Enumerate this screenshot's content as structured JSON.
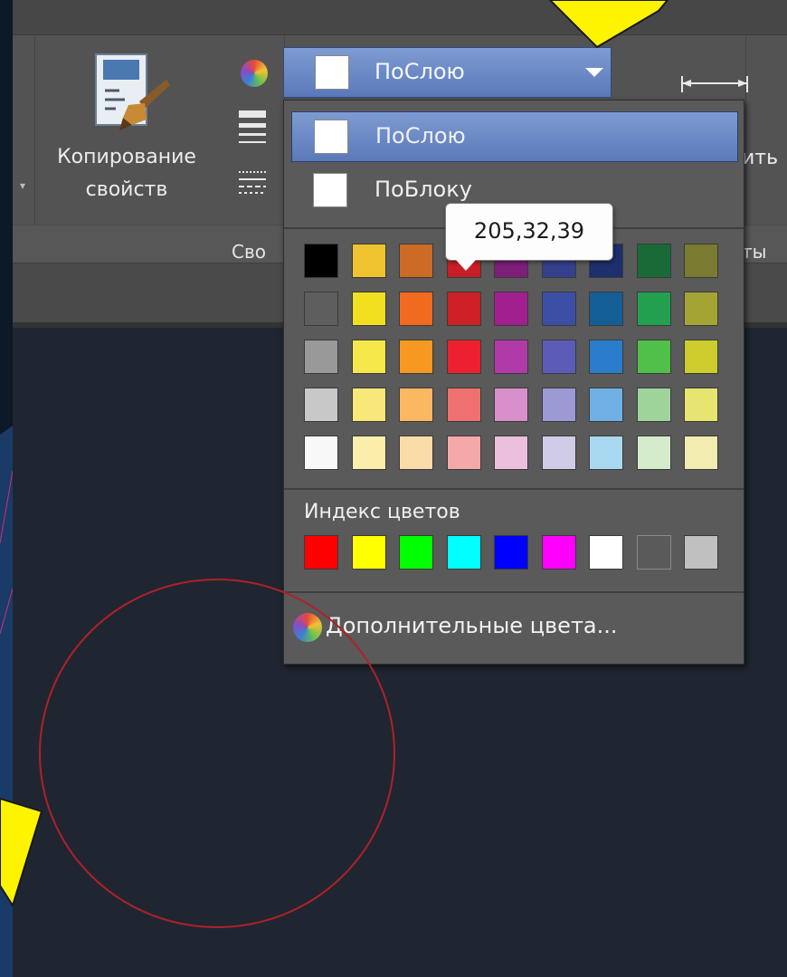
{
  "ribbon": {
    "copy_properties_label": "Копирование\nсвойств",
    "group_label_left": "Сво",
    "label_right_1": "ить",
    "label_right_2": "ты"
  },
  "color_combo": {
    "selected": "ПоСлою"
  },
  "dropdown": {
    "items": [
      {
        "label": "ПоСлою"
      },
      {
        "label": "ПоБлоку"
      }
    ],
    "tooltip": "205,32,39",
    "palette_rows": [
      [
        "#000000",
        "#f0c430",
        "#cd6a26",
        "#c81e28",
        "#7d1e78",
        "#34408c",
        "#1d2f6c",
        "#1a6a38",
        "#7a7a30"
      ],
      [
        "#5e5e5e",
        "#f2e020",
        "#f26a20",
        "#cd2027",
        "#a21f90",
        "#3c4fa6",
        "#145e96",
        "#22a050",
        "#a4a434"
      ],
      [
        "#999999",
        "#f6e84a",
        "#f79820",
        "#ee2030",
        "#b03aa8",
        "#5c5cb8",
        "#2a7ccc",
        "#50c04a",
        "#cccc2c"
      ],
      [
        "#c8c8c8",
        "#f8e878",
        "#fab860",
        "#f07070",
        "#d890cc",
        "#9c9ad4",
        "#70b0e4",
        "#9ed49a",
        "#e8e470"
      ],
      [
        "#f8f8f8",
        "#faeeaa",
        "#fadca8",
        "#f4a8a8",
        "#ecc0dc",
        "#d0cce8",
        "#a8d8f0",
        "#d4eccc",
        "#f2ecb0"
      ]
    ],
    "index_label": "Индекс цветов",
    "index_colors": [
      "#ff0000",
      "#ffff00",
      "#00ff00",
      "#00ffff",
      "#0000ff",
      "#ff00ff",
      "#ffffff",
      "#5a5a5a",
      "#c0c0c0"
    ],
    "more_colors_label": "Дополнительные цвета..."
  },
  "colors": {
    "highlight_blue": "#6a88c6",
    "pointer_arrow": "#fff400",
    "circle_stroke": "#b0202a",
    "drawing_bg": "#1f2631"
  }
}
